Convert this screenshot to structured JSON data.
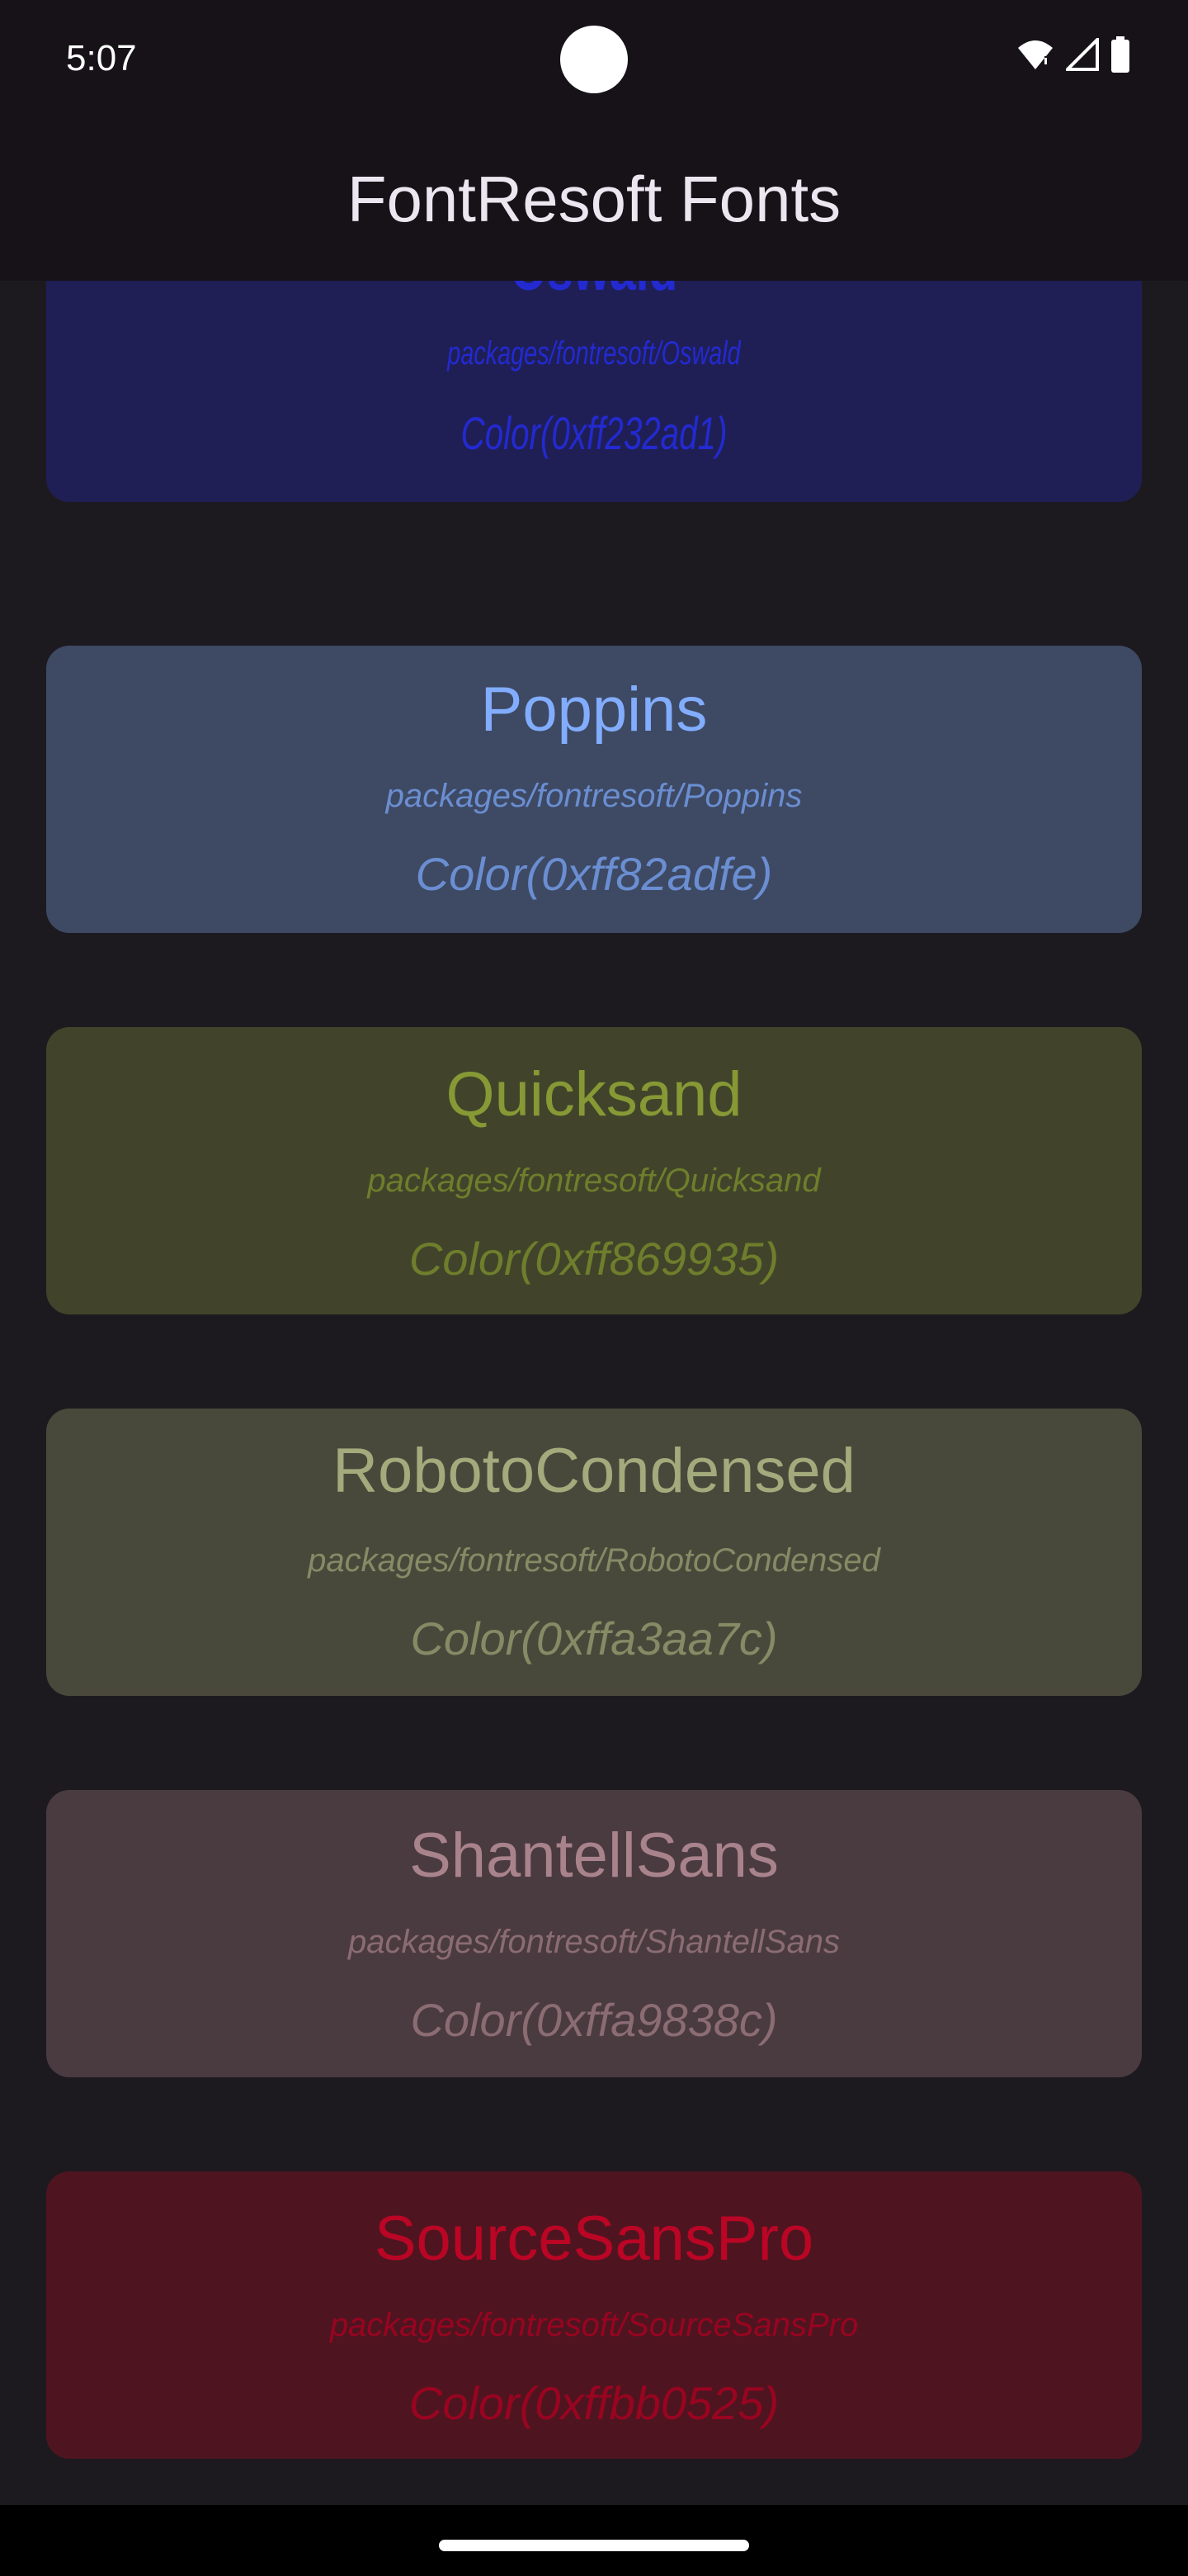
{
  "status_bar": {
    "time": "5:07",
    "icons": [
      "wifi-icon",
      "signal-icon",
      "battery-icon"
    ]
  },
  "app_bar": {
    "title": "FontResoft Fonts"
  },
  "fonts": [
    {
      "name": "Oswald",
      "path": "packages/fontresoft/Oswald",
      "color_label": "Color(0xff232ad1)",
      "colors": {
        "background": "#1f1f55",
        "name": "#232ad1",
        "path": "#232ad1",
        "color_label": "#232ad1"
      }
    },
    {
      "name": "Poppins",
      "path": "packages/fontresoft/Poppins",
      "color_label": "Color(0xff82adfe)",
      "colors": {
        "background": "#3e4964",
        "name": "#82adfe",
        "path": "#6a8ed1",
        "color_label": "#6a8ed1"
      }
    },
    {
      "name": "Quicksand",
      "path": "packages/fontresoft/Quicksand",
      "color_label": "Color(0xff869935)",
      "colors": {
        "background": "#41442a",
        "name": "#869935",
        "path": "#6e7e2c",
        "color_label": "#6e7e2c"
      }
    },
    {
      "name": "RobotoCondensed",
      "path": "packages/fontresoft/RobotoCondensed",
      "color_label": "Color(0xffa3aa7c)",
      "colors": {
        "background": "#49493b",
        "name": "#a3aa7c",
        "path": "#868b66",
        "color_label": "#868b66"
      }
    },
    {
      "name": "ShantellSans",
      "path": "packages/fontresoft/ShantellSans",
      "color_label": "Color(0xffa9838c)",
      "colors": {
        "background": "#4a3b41",
        "name": "#a9838c",
        "path": "#8b6c73",
        "color_label": "#8b6c73"
      }
    },
    {
      "name": "SourceSansPro",
      "path": "packages/fontresoft/SourceSansPro",
      "color_label": "Color(0xffbb0525)",
      "colors": {
        "background": "#4e1520",
        "name": "#bb0525",
        "path": "#990420",
        "color_label": "#990420"
      }
    }
  ]
}
